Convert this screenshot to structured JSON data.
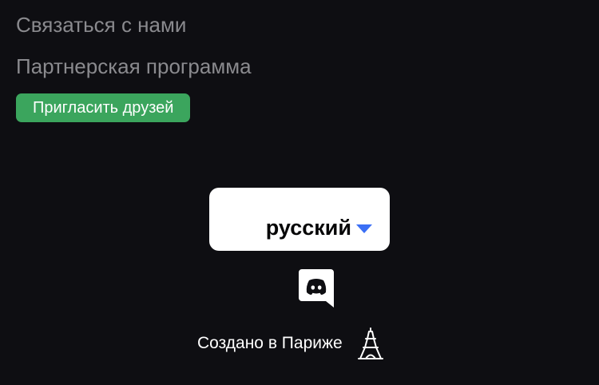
{
  "footer": {
    "links": [
      {
        "label": "Связаться с нами"
      },
      {
        "label": "Партнерская программа"
      }
    ],
    "invite_button_label": "Пригласить друзей"
  },
  "language_select": {
    "selected": "русский",
    "icon": "chevron-down-icon",
    "accent_color": "#3b6ff5"
  },
  "brand": {
    "icon": "discord-logo-icon"
  },
  "made_in": {
    "text": "Создано в Париже",
    "icon": "eiffel-tower-icon"
  },
  "colors": {
    "background": "#0e0e12",
    "link_text": "#8a8a8e",
    "invite_button": "#3ba55d",
    "select_background": "#ffffff"
  }
}
